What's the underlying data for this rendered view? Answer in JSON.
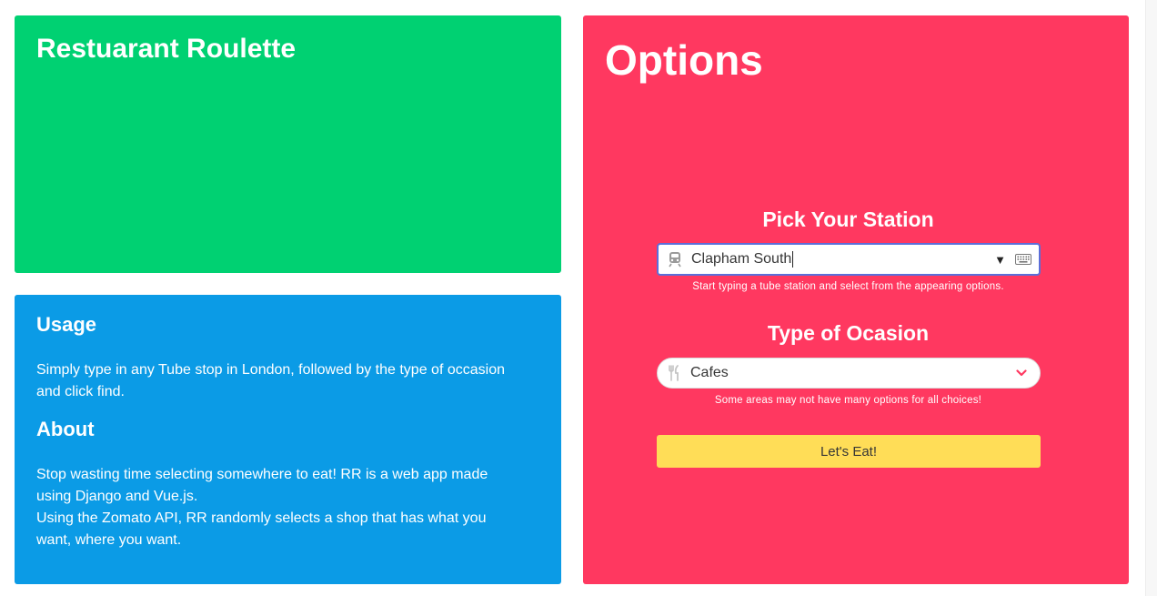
{
  "brand_card": {
    "title": "Restuarant Roulette",
    "color": "#00d172"
  },
  "info_card": {
    "color": "#0b9be6",
    "usage_heading": "Usage",
    "usage_text": "Simply type in any Tube stop in London, followed by the type of occasion and click find.",
    "about_heading": "About",
    "about_line1": "Stop wasting time selecting somewhere to eat! RR is a web app made using Django and Vue.js.",
    "about_line2": "Using the Zomato API, RR randomly selects a shop that has what you want, where you want."
  },
  "options_card": {
    "title": "Options",
    "color": "#ff3860",
    "station": {
      "heading": "Pick Your Station",
      "value": "Clapham South",
      "icon": "train-icon",
      "help": "Start typing a tube station and select from the appearing options."
    },
    "occasion": {
      "heading": "Type of Ocasion",
      "selected": "Cafes",
      "icon": "utensils-icon",
      "help": "Some areas may not have many options for all choices!"
    },
    "submit_label": "Let's Eat!",
    "submit_color": "#ffdd57"
  }
}
